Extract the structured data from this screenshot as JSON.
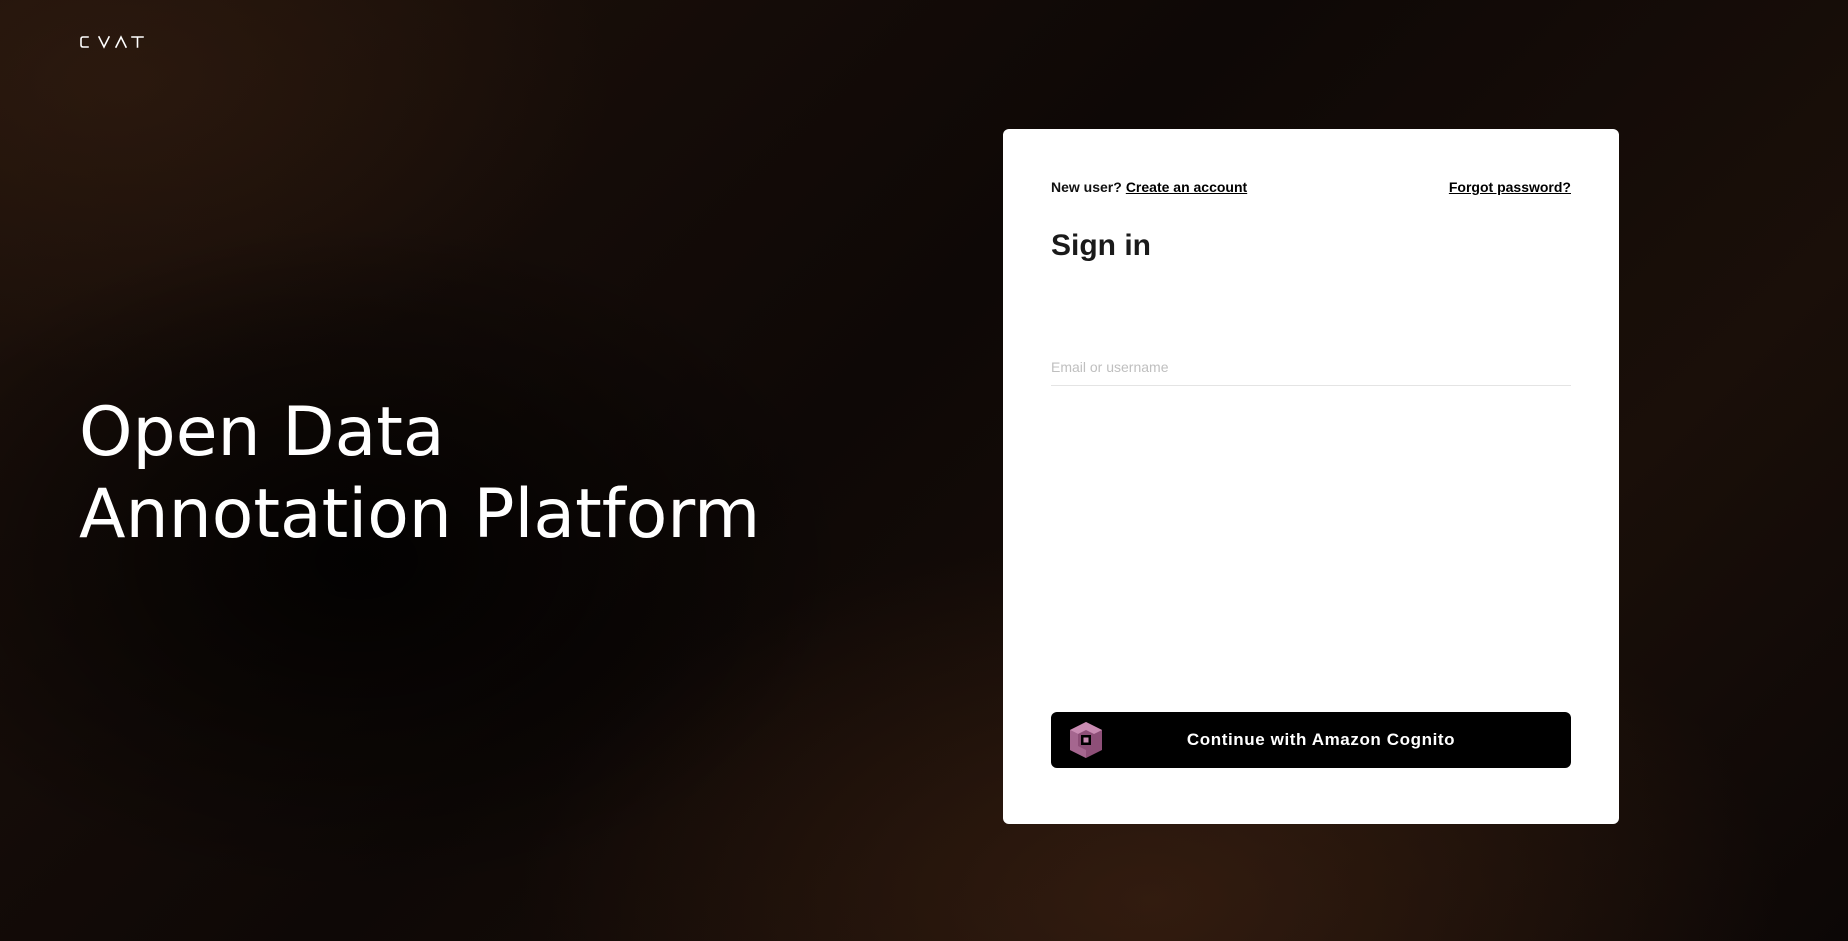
{
  "brand": {
    "logo_text": "CVAT"
  },
  "hero": {
    "line1": "Open Data",
    "line2": "Annotation Platform"
  },
  "signin": {
    "new_user_text": "New user?",
    "create_account_link": "Create an account",
    "forgot_password_link": "Forgot password?",
    "title": "Sign in",
    "email_placeholder": "Email or username",
    "email_value": "",
    "sso_button_label": "Continue with Amazon Cognito",
    "sso_icon": "amazon-cognito-icon"
  },
  "colors": {
    "card_background": "#ffffff",
    "button_background": "#000000",
    "cognito_icon": "#b86a9a",
    "text_primary": "#1a1a1a"
  }
}
